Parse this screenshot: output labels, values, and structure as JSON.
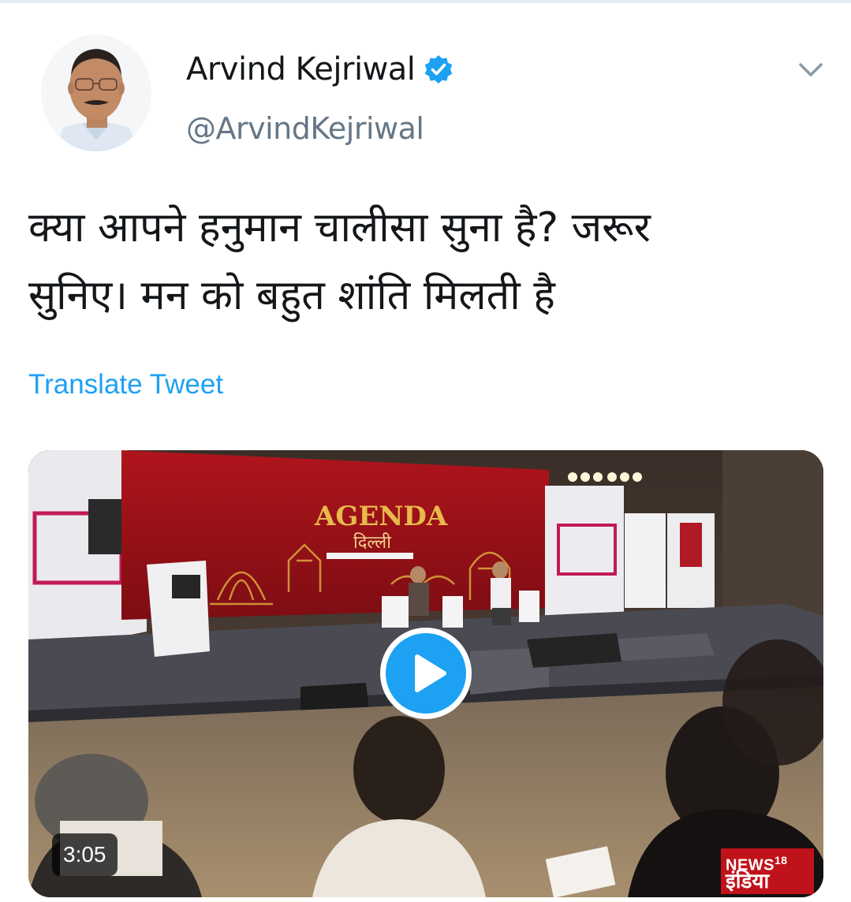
{
  "tweet": {
    "author": {
      "display_name": "Arvind Kejriwal",
      "handle": "@ArvindKejriwal",
      "verified": true,
      "avatar_icon": "profile-photo"
    },
    "text_line1": "क्या आपने हनुमान चालीसा सुना है? जरूर",
    "text_line2": "सुनिए। मन को बहुत शांति मिलती है",
    "translate_label": "Translate Tweet",
    "menu_icon": "chevron-down-icon"
  },
  "media": {
    "type": "video",
    "duration": "3:05",
    "stage_title": "AGENDA",
    "stage_subtitle": "दिल्ली",
    "channel_logo": {
      "top": "NEWS",
      "number": "18",
      "bottom": "इंडिया"
    },
    "play_icon": "play-icon"
  },
  "colors": {
    "accent": "#1da1f2",
    "text": "#14171a",
    "secondary_text": "#657786",
    "logo_red": "#c0121a"
  }
}
